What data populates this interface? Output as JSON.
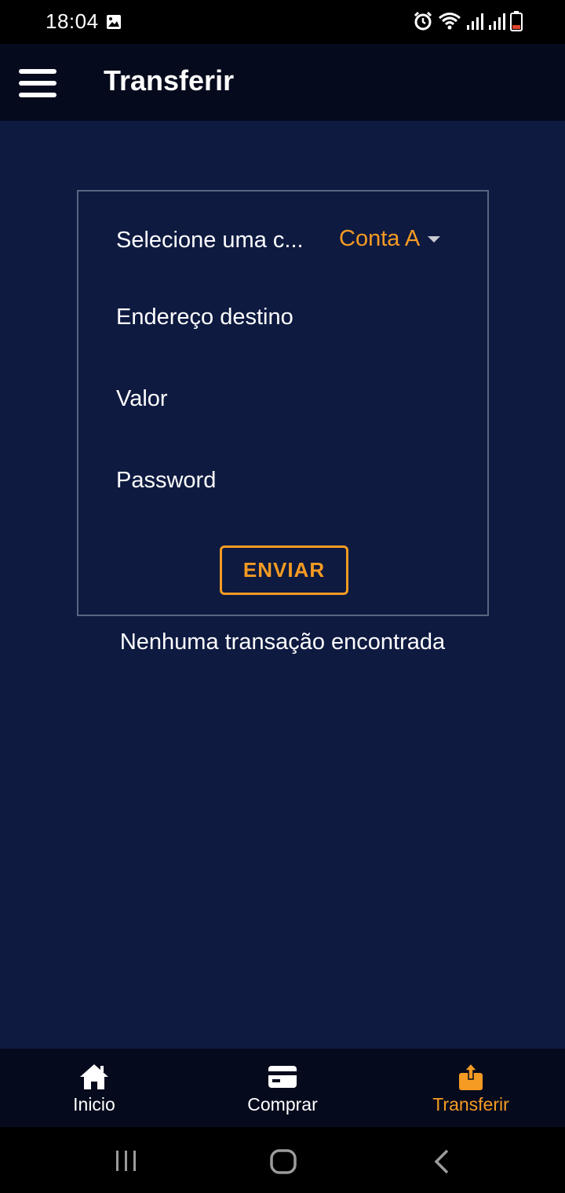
{
  "status_bar": {
    "time": "18:04",
    "icons": [
      "image-icon",
      "alarm-icon",
      "wifi-icon",
      "signal-icon",
      "signal-icon",
      "battery-low-icon"
    ]
  },
  "app_bar": {
    "title": "Transferir",
    "menu_icon": "hamburger-menu-icon"
  },
  "form": {
    "account_label": "Selecione uma c...",
    "account_selected": "Conta A",
    "address_placeholder": "Endereço destino",
    "amount_placeholder": "Valor",
    "password_placeholder": "Password",
    "submit_label": "ENVIAR"
  },
  "empty_message": "Nenhuma transação encontrada",
  "bottom_nav": {
    "items": [
      {
        "label": "Inicio",
        "icon": "home-icon",
        "active": false
      },
      {
        "label": "Comprar",
        "icon": "credit-card-icon",
        "active": false
      },
      {
        "label": "Transferir",
        "icon": "share-upload-icon",
        "active": true
      }
    ]
  },
  "colors": {
    "accent": "#f59b23",
    "background": "#0e1a40",
    "bar": "#050a1d"
  }
}
